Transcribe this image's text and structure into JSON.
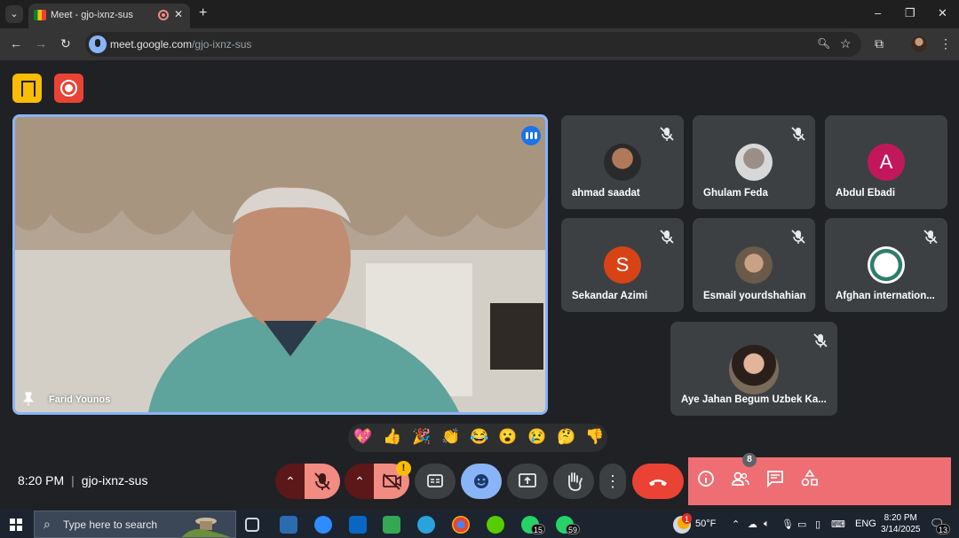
{
  "browser": {
    "tab_title": "Meet - gjo-ixnz-sus",
    "new_tab": "+",
    "url_domain": "meet.google.com",
    "url_path": "/gjo-ixnz-sus",
    "window_controls": {
      "minimize": "–",
      "restore": "❐",
      "close": "✕"
    }
  },
  "meeting": {
    "main_speaker": "Farid Younos",
    "participants": [
      {
        "name": "ahmad saadat",
        "avatar": "photo"
      },
      {
        "name": "Ghulam Feda",
        "avatar": "photo"
      },
      {
        "name": "Abdul Ebadi",
        "avatar": "A",
        "color": "#c2185b"
      },
      {
        "name": "Sekandar Azimi",
        "avatar": "S",
        "color": "#d84315"
      },
      {
        "name": "Esmail yourdshahian",
        "avatar": "photo"
      },
      {
        "name": "Afghan internation...",
        "avatar": "logo"
      },
      {
        "name": "Aye Jahan Begum Uzbek Ka...",
        "avatar": "photo"
      }
    ],
    "reactions": [
      "💖",
      "👍",
      "🎉",
      "👏",
      "😂",
      "😮",
      "😢",
      "🤔",
      "👎"
    ],
    "time": "8:20 PM",
    "separator": "|",
    "meeting_code": "gjo-ixnz-sus",
    "people_count": "8",
    "camera_warning": "!"
  },
  "taskbar": {
    "search_placeholder": "Type here to search",
    "badges": {
      "whatsapp1": "15",
      "whatsapp2": "59",
      "notifications": "13",
      "weather_alert": "1"
    },
    "weather": "50°F",
    "language": "ENG",
    "time": "8:20 PM",
    "date": "3/14/2025"
  },
  "colors": {
    "accent": "#8ab4f8",
    "hangup": "#ea4335",
    "panel": "#ee6e73",
    "host": "#fbbc04"
  }
}
